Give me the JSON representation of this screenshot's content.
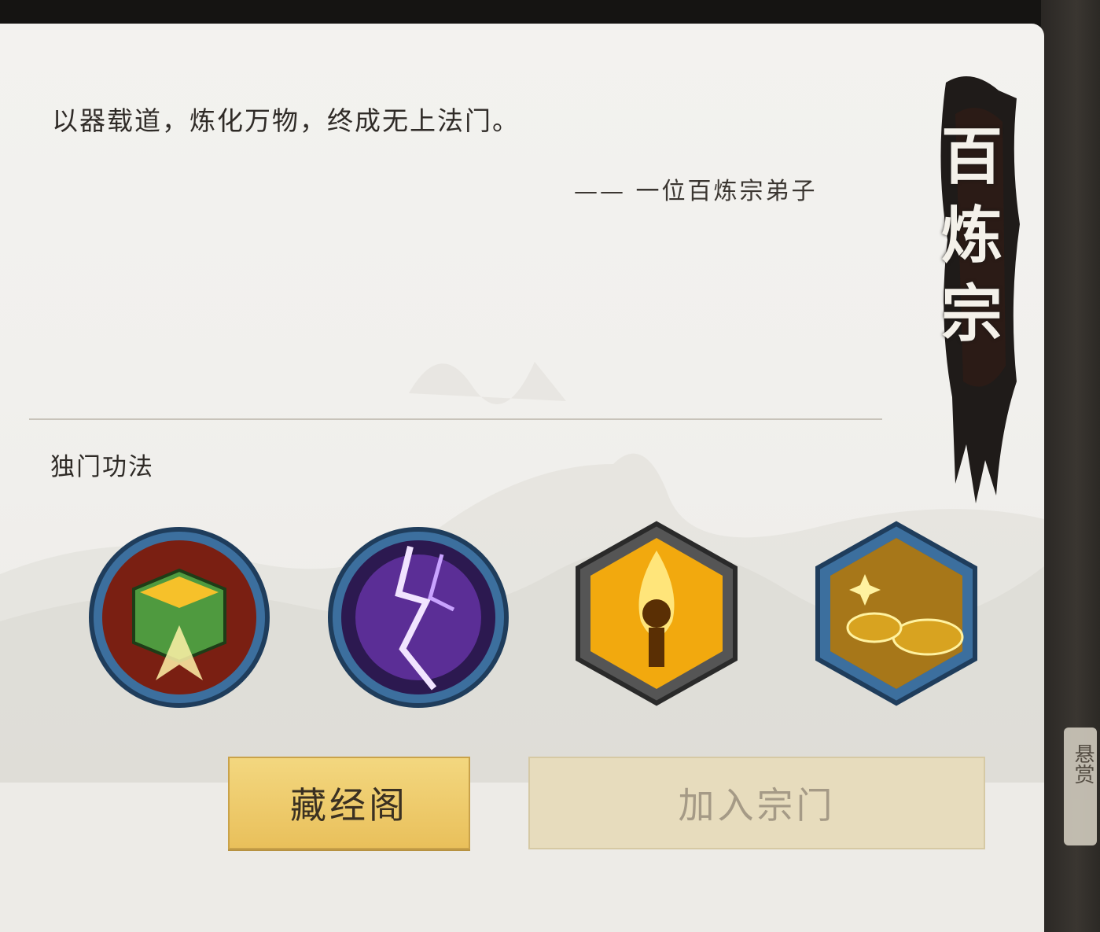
{
  "sect": {
    "name": "百炼宗",
    "quote": "以器载道，炼化万物，终成无上法门。",
    "author": "—— 一位百炼宗弟子"
  },
  "skills_section": {
    "title": "独门功法",
    "skills": [
      {
        "icon": "forge-chest-icon",
        "frame": "circle",
        "colors": [
          "#f6c12a",
          "#4f9a3f",
          "#7a1f12"
        ]
      },
      {
        "icon": "lightning-icon",
        "frame": "circle",
        "colors": [
          "#7b3cc5",
          "#c9a3ff",
          "#2c1950"
        ]
      },
      {
        "icon": "flame-figure-icon",
        "frame": "hexagon",
        "colors": [
          "#f2a90e",
          "#ffe57a",
          "#5a2f04"
        ]
      },
      {
        "icon": "gold-coins-icon",
        "frame": "hexagon",
        "colors": [
          "#d8a320",
          "#fff2a0",
          "#6b4410"
        ]
      }
    ]
  },
  "buttons": {
    "library": "藏经阁",
    "join": "加入宗门"
  },
  "side_tab": {
    "label": "悬赏"
  }
}
